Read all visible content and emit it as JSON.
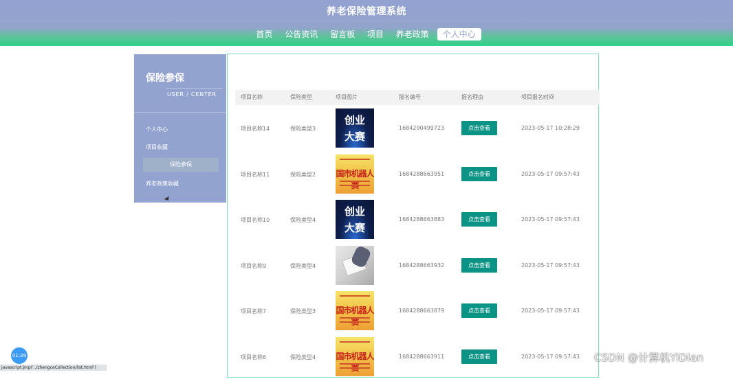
{
  "site_title": "养老保险管理系统",
  "nav": [
    "首页",
    "公告资讯",
    "留言板",
    "项目",
    "养老政策",
    "个人中心"
  ],
  "nav_active": "个人中心",
  "sidebar": {
    "title": "保险参保",
    "subtitle": "USER / CENTER",
    "items": [
      "个人中心",
      "项目收藏",
      "保险参保",
      "养老政策收藏"
    ],
    "active": "保险参保"
  },
  "table": {
    "headers": [
      "项目名称",
      "保险类型",
      "项目图片",
      "报名编号",
      "报名理由",
      "项目报名时间"
    ],
    "rows": [
      {
        "name": "项目名称14",
        "type": "保险类型3",
        "image": "创业大赛",
        "number": "1684290499723",
        "button": "点击查看",
        "time": "2023-05-17 10:28:29"
      },
      {
        "name": "项目名称11",
        "type": "保险类型2",
        "image": "机器人赛",
        "number": "1684288663951",
        "button": "点击查看",
        "time": "2023-05-17 09:57:43"
      },
      {
        "name": "项目名称10",
        "type": "保险类型4",
        "image": "创业大赛",
        "number": "1684288663883",
        "button": "点击查看",
        "time": "2023-05-17 09:57:43"
      },
      {
        "name": "项目名称9",
        "type": "保险类型4",
        "image": "desk",
        "number": "1684288663932",
        "button": "点击查看",
        "time": "2023-05-17 09:57:43"
      },
      {
        "name": "项目名称7",
        "type": "保险类型3",
        "image": "机器人赛",
        "number": "1684288663879",
        "button": "点击查看",
        "time": "2023-05-17 09:57:43"
      },
      {
        "name": "项目名称6",
        "type": "保险类型4",
        "image": "机器人赛",
        "number": "1684288663911",
        "button": "点击查看",
        "time": "2023-05-17 09:57:43"
      }
    ]
  },
  "image_text": {
    "cy_line1": "创业",
    "cy_line2": "大赛",
    "jq": "国市机器人赛"
  },
  "timer": "01:39",
  "status_url": "javascript:jmp('../zhengceCollection/list.html')",
  "watermark": "CSDN @计算机YiDian",
  "colors": {
    "header": "#93a2d0",
    "header_accent": "#2ecf8a",
    "button": "#0b9386",
    "sidebar": "#93a3cf",
    "main_border": "#7ae0b8"
  }
}
